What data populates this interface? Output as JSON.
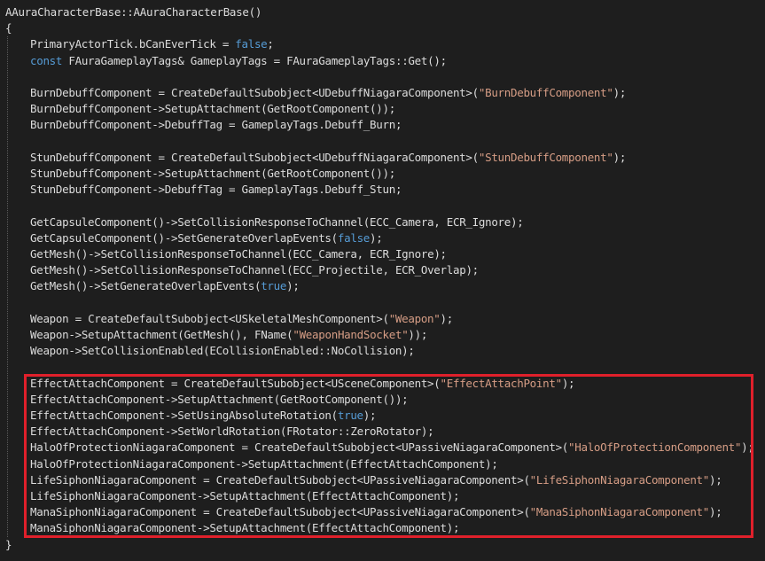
{
  "editor": {
    "lines": [
      {
        "text": "AAuraCharacterBase::AAuraCharacterBase()",
        "indent": 0
      },
      {
        "text": "{",
        "indent": 0
      },
      {
        "text": "PrimaryActorTick.bCanEverTick = false;",
        "indent": 1
      },
      {
        "text": "const FAuraGameplayTags& GameplayTags = FAuraGameplayTags::Get();",
        "indent": 1
      },
      {
        "text": "",
        "indent": 1
      },
      {
        "text": "BurnDebuffComponent = CreateDefaultSubobject<UDebuffNiagaraComponent>(\"BurnDebuffComponent\");",
        "indent": 1
      },
      {
        "text": "BurnDebuffComponent->SetupAttachment(GetRootComponent());",
        "indent": 1
      },
      {
        "text": "BurnDebuffComponent->DebuffTag = GameplayTags.Debuff_Burn;",
        "indent": 1
      },
      {
        "text": "",
        "indent": 1
      },
      {
        "text": "StunDebuffComponent = CreateDefaultSubobject<UDebuffNiagaraComponent>(\"StunDebuffComponent\");",
        "indent": 1
      },
      {
        "text": "StunDebuffComponent->SetupAttachment(GetRootComponent());",
        "indent": 1
      },
      {
        "text": "StunDebuffComponent->DebuffTag = GameplayTags.Debuff_Stun;",
        "indent": 1
      },
      {
        "text": "",
        "indent": 1
      },
      {
        "text": "GetCapsuleComponent()->SetCollisionResponseToChannel(ECC_Camera, ECR_Ignore);",
        "indent": 1
      },
      {
        "text": "GetCapsuleComponent()->SetGenerateOverlapEvents(false);",
        "indent": 1
      },
      {
        "text": "GetMesh()->SetCollisionResponseToChannel(ECC_Camera, ECR_Ignore);",
        "indent": 1
      },
      {
        "text": "GetMesh()->SetCollisionResponseToChannel(ECC_Projectile, ECR_Overlap);",
        "indent": 1
      },
      {
        "text": "GetMesh()->SetGenerateOverlapEvents(true);",
        "indent": 1
      },
      {
        "text": "",
        "indent": 1
      },
      {
        "text": "Weapon = CreateDefaultSubobject<USkeletalMeshComponent>(\"Weapon\");",
        "indent": 1
      },
      {
        "text": "Weapon->SetupAttachment(GetMesh(), FName(\"WeaponHandSocket\"));",
        "indent": 1
      },
      {
        "text": "Weapon->SetCollisionEnabled(ECollisionEnabled::NoCollision);",
        "indent": 1
      },
      {
        "text": "",
        "indent": 1
      },
      {
        "text": "EffectAttachComponent = CreateDefaultSubobject<USceneComponent>(\"EffectAttachPoint\");",
        "indent": 1
      },
      {
        "text": "EffectAttachComponent->SetupAttachment(GetRootComponent());",
        "indent": 1
      },
      {
        "text": "EffectAttachComponent->SetUsingAbsoluteRotation(true);",
        "indent": 1
      },
      {
        "text": "EffectAttachComponent->SetWorldRotation(FRotator::ZeroRotator);",
        "indent": 1
      },
      {
        "text": "HaloOfProtectionNiagaraComponent = CreateDefaultSubobject<UPassiveNiagaraComponent>(\"HaloOfProtectionComponent\");",
        "indent": 1
      },
      {
        "text": "HaloOfProtectionNiagaraComponent->SetupAttachment(EffectAttachComponent);",
        "indent": 1
      },
      {
        "text": "LifeSiphonNiagaraComponent = CreateDefaultSubobject<UPassiveNiagaraComponent>(\"LifeSiphonNiagaraComponent\");",
        "indent": 1
      },
      {
        "text": "LifeSiphonNiagaraComponent->SetupAttachment(EffectAttachComponent);",
        "indent": 1
      },
      {
        "text": "ManaSiphonNiagaraComponent = CreateDefaultSubobject<UPassiveNiagaraComponent>(\"ManaSiphonNiagaraComponent\");",
        "indent": 1
      },
      {
        "text": "ManaSiphonNiagaraComponent->SetupAttachment(EffectAttachComponent);",
        "indent": 1
      },
      {
        "text": "}",
        "indent": 0
      }
    ],
    "highlight": {
      "from_line": 24,
      "to_line": 33,
      "color": "#e0202b"
    },
    "colors": {
      "background": "#1e1e1e",
      "default": "#dcdcdc",
      "keyword": "#569cd6",
      "string": "#d69d85",
      "type": "#4ec9b0"
    }
  }
}
